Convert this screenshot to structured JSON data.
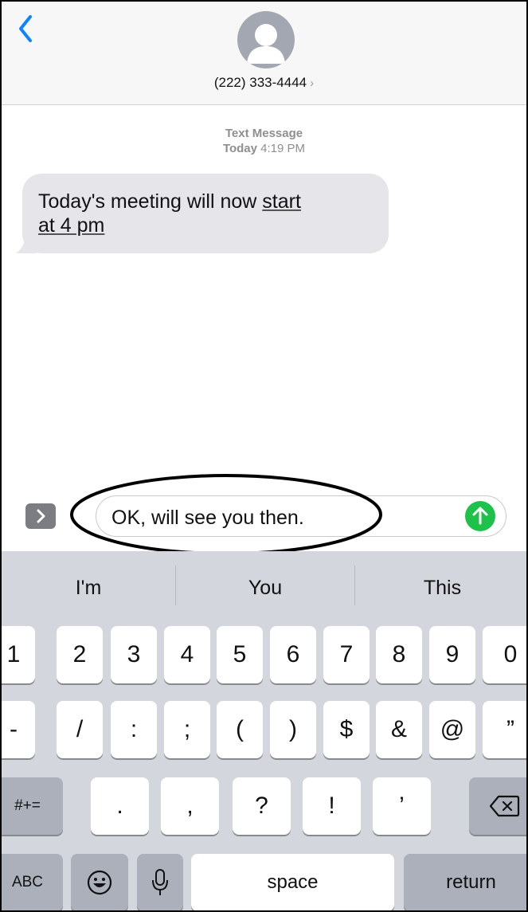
{
  "header": {
    "contact": "(222) 333-4444",
    "contact_chevron": "›",
    "back_icon": "chevron-left-icon",
    "avatar_icon": "person-silhouette-icon"
  },
  "thread": {
    "meta_line1": "Text Message",
    "meta_day": "Today",
    "meta_time": "4:19 PM",
    "message": {
      "part1": "Today's meeting will now ",
      "link1": "start",
      "link2": "at 4 pm"
    }
  },
  "composer": {
    "value": "OK, will see you then.",
    "expand_icon": "chevron-right-icon",
    "send_icon": "arrow-up-icon"
  },
  "suggestions": [
    "I'm",
    "You",
    "This"
  ],
  "keyboard": {
    "row1": [
      "1",
      "2",
      "3",
      "4",
      "5",
      "6",
      "7",
      "8",
      "9",
      "0"
    ],
    "row2": [
      "-",
      "/",
      ":",
      ";",
      "(",
      ")",
      "$",
      "&",
      "@",
      "”"
    ],
    "row3": {
      "mode": "#+=",
      "keys": [
        ".",
        ",",
        "?",
        "!",
        "’"
      ],
      "delete_icon": "backspace-icon"
    },
    "row4": {
      "abc": "ABC",
      "emoji_icon": "emoji-icon",
      "mic_icon": "microphone-icon",
      "space": "space",
      "return": "return"
    }
  },
  "colors": {
    "accent": "#0a84ff",
    "bubble": "#e5e5ea",
    "send": "#1ec24b",
    "keyboard_bg": "#d3d6dc"
  }
}
